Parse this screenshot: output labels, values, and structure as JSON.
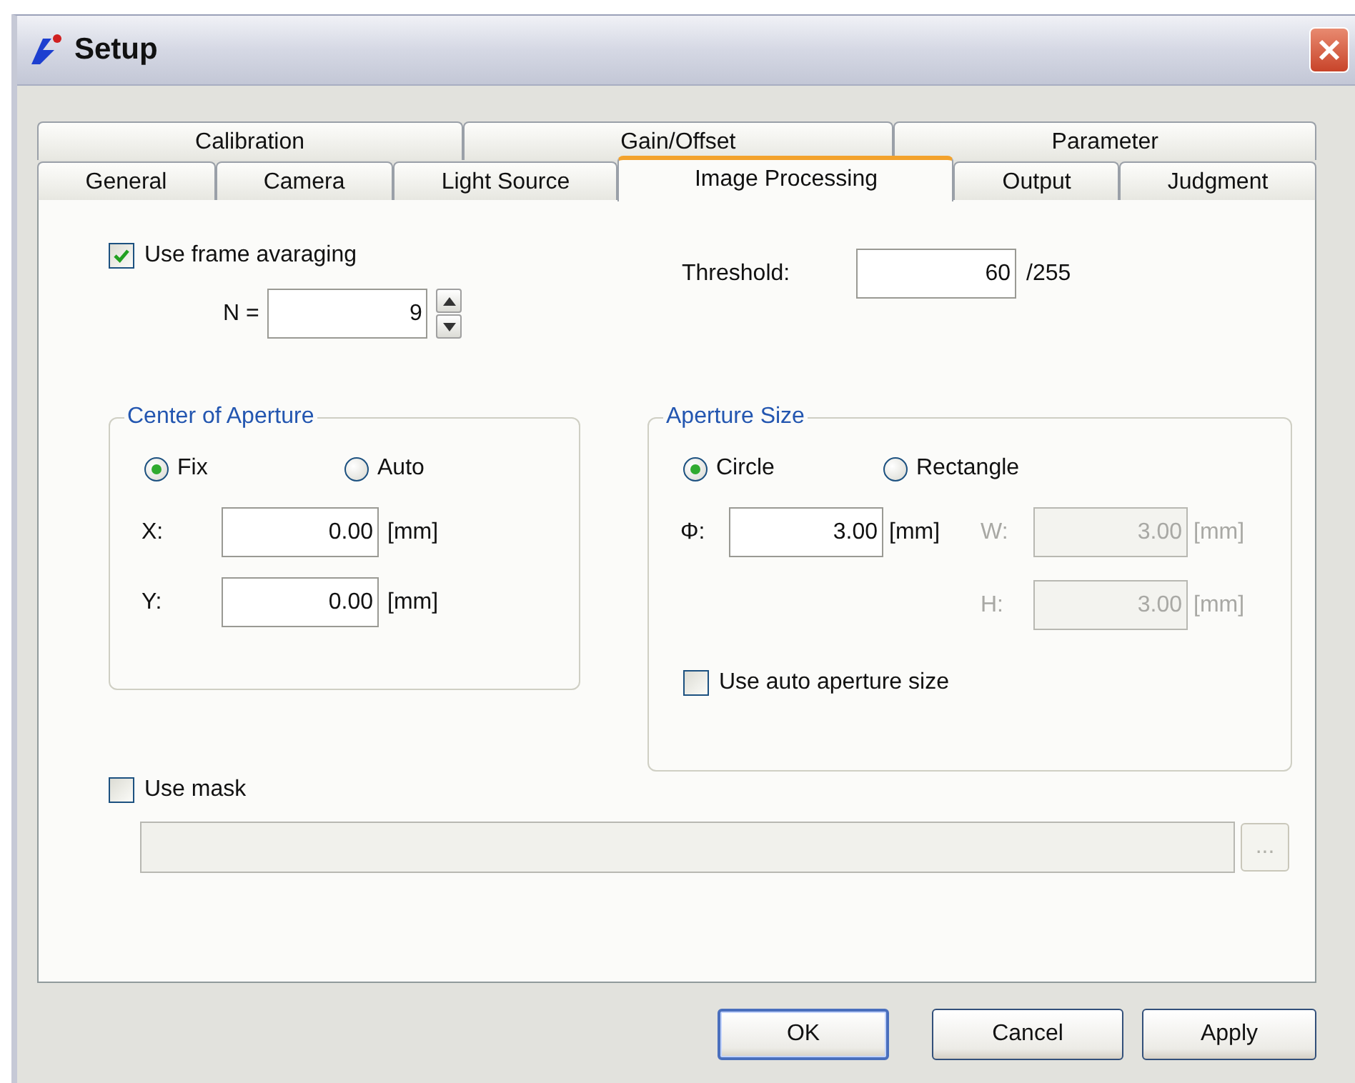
{
  "window": {
    "title": "Setup"
  },
  "tab_rows": [
    {
      "tabs": [
        {
          "label": "Calibration",
          "selected": false
        },
        {
          "label": "Gain/Offset",
          "selected": false
        },
        {
          "label": "Parameter",
          "selected": false
        }
      ]
    },
    {
      "tabs": [
        {
          "label": "General",
          "selected": false
        },
        {
          "label": "Camera",
          "selected": false
        },
        {
          "label": "Light Source",
          "selected": false
        },
        {
          "label": "Image Processing",
          "selected": true
        },
        {
          "label": "Output",
          "selected": false
        },
        {
          "label": "Judgment",
          "selected": false
        }
      ]
    }
  ],
  "frame_averaging": {
    "label": "Use frame avaraging",
    "checked": true
  },
  "n": {
    "label": "N =",
    "value": "9"
  },
  "threshold": {
    "label": "Threshold:",
    "value": "60",
    "suffix": "/255"
  },
  "center_of_aperture": {
    "title": "Center of Aperture",
    "modes": [
      {
        "label": "Fix",
        "selected": true
      },
      {
        "label": "Auto",
        "selected": false
      }
    ],
    "fields": [
      {
        "label": "X:",
        "value": "0.00",
        "unit": "[mm]"
      },
      {
        "label": "Y:",
        "value": "0.00",
        "unit": "[mm]"
      }
    ]
  },
  "aperture_size": {
    "title": "Aperture Size",
    "shapes": [
      {
        "label": "Circle",
        "selected": true
      },
      {
        "label": "Rectangle",
        "selected": false
      }
    ],
    "diameter": {
      "label": "Φ:",
      "value": "3.00",
      "unit": "[mm]",
      "disabled": false
    },
    "width": {
      "label": "W:",
      "value": "3.00",
      "unit": "[mm]",
      "disabled": true
    },
    "height": {
      "label": "H:",
      "value": "3.00",
      "unit": "[mm]",
      "disabled": true
    },
    "auto_size": {
      "label": "Use auto aperture size",
      "checked": false
    }
  },
  "mask": {
    "label": "Use mask",
    "checked": false,
    "path": {
      "disabled": true
    },
    "browse": {
      "label": "...",
      "disabled": true
    }
  },
  "buttons": [
    {
      "label": "OK",
      "default": true
    },
    {
      "label": "Cancel",
      "default": false
    },
    {
      "label": "Apply",
      "default": false
    }
  ]
}
